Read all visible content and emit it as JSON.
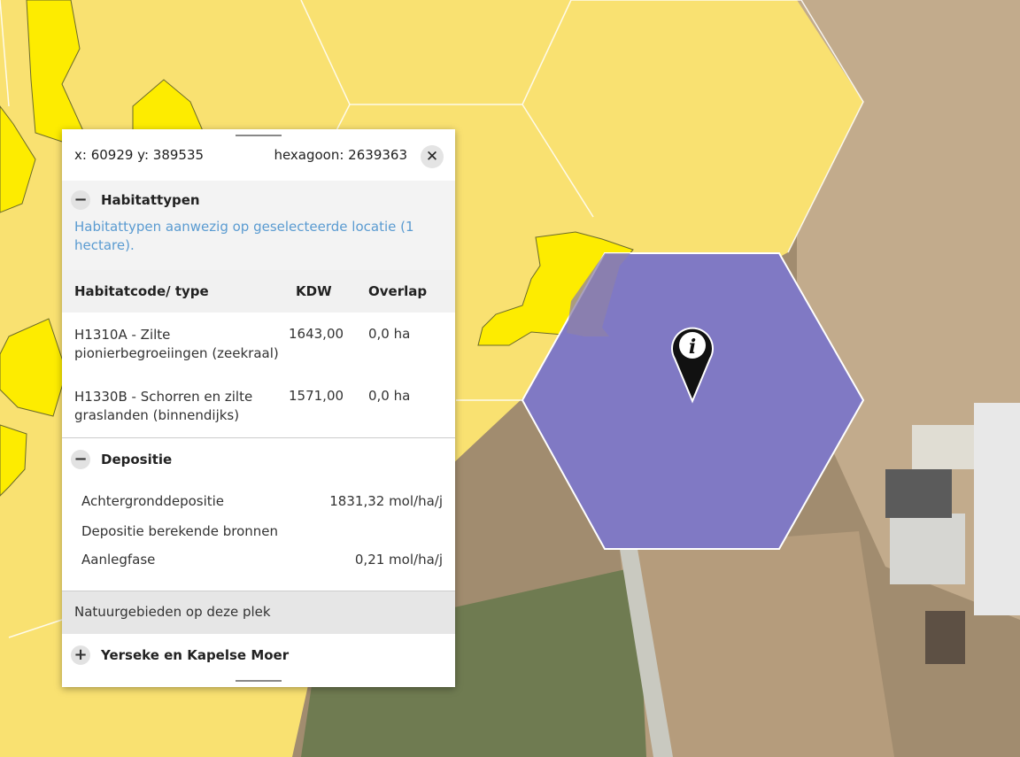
{
  "panel": {
    "coords_text": "x: 60929 y: 389535",
    "hex_text": "hexagoon: 2639363",
    "close_symbol": "✕",
    "habitat": {
      "toggle": "−",
      "title": "Habitattypen",
      "note": "Habitattypen aanwezig op geselecteerde locatie (1 hectare).",
      "columns": [
        "Habitatcode/ type",
        "KDW",
        "Overlap"
      ],
      "rows": [
        {
          "name": "H1310A - Zilte pionierbegroeiingen (zeekraal)",
          "kdw": "1643,00",
          "overlap": "0,0 ha"
        },
        {
          "name": "H1330B - Schorren en zilte graslanden (binnendijks)",
          "kdw": "1571,00",
          "overlap": "0,0 ha"
        }
      ]
    },
    "deposition": {
      "toggle": "−",
      "title": "Depositie",
      "rows": [
        {
          "label": "Achtergronddepositie",
          "value": "1831,32 mol/ha/j"
        },
        {
          "label": "Depositie berekende bronnen",
          "value": ""
        },
        {
          "label": "Aanlegfase",
          "value": "0,21 mol/ha/j"
        }
      ]
    },
    "nature_heading": "Natuurgebieden op deze plek",
    "area": {
      "toggle": "+",
      "title": "Yerseke en Kapelse Moer"
    }
  },
  "map": {
    "colors": {
      "hexagon_fill": "#f9e171",
      "habitat_polygon": "#fdec00",
      "selected_hexagon": "#8079c4",
      "field_light": "#c7b194",
      "field_dark": "#9a8468",
      "grass": "#6f7b51"
    },
    "marker_icon": "info-pin-icon",
    "marker_label": "i"
  }
}
